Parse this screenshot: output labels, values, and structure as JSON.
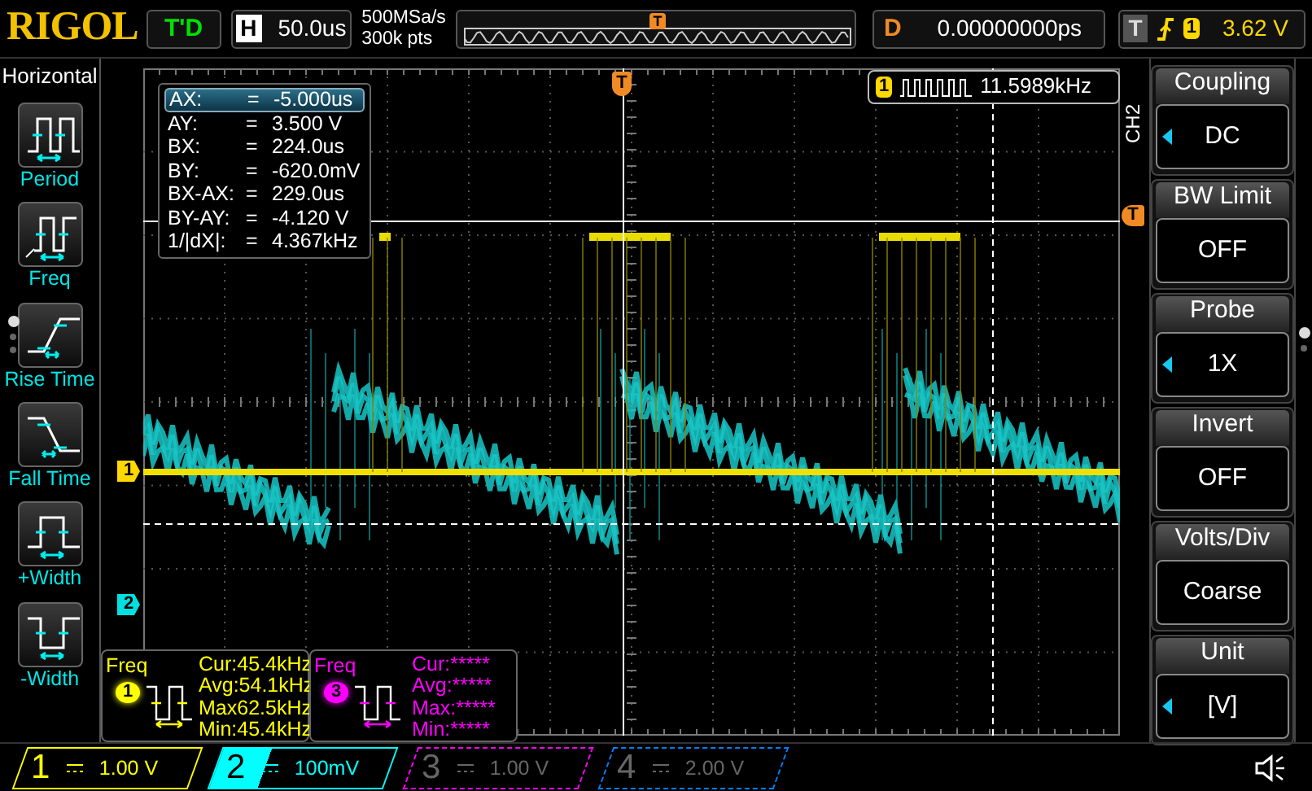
{
  "brand": "RIGOL",
  "run_status": "T'D",
  "horizontal": {
    "label": "H",
    "timebase": "50.0us",
    "sample_rate": "500MSa/s",
    "memory_depth": "300k pts",
    "marker": "T"
  },
  "delay": {
    "label": "D",
    "value": "0.00000000ps"
  },
  "trigger": {
    "label": "T",
    "channel": "1",
    "level": "3.62 V"
  },
  "left_menu": {
    "title": "Horizontal",
    "items": [
      {
        "label": "Period",
        "kind": "period"
      },
      {
        "label": "Freq",
        "kind": "freq"
      },
      {
        "label": "Rise Time",
        "kind": "rise"
      },
      {
        "label": "Fall Time",
        "kind": "fall"
      },
      {
        "label": "+Width",
        "kind": "pwidth"
      },
      {
        "label": "-Width",
        "kind": "nwidth"
      }
    ],
    "pages": [
      {
        "selected": true
      },
      {
        "selected": false
      },
      {
        "selected": false
      }
    ]
  },
  "cursor_readout": [
    {
      "name": "AX:",
      "equals": "=",
      "value": "-5.000us",
      "selected": true
    },
    {
      "name": "AY:",
      "equals": "=",
      "value": "3.500 V",
      "selected": false
    },
    {
      "name": "BX:",
      "equals": "=",
      "value": "224.0us",
      "selected": false
    },
    {
      "name": "BY:",
      "equals": "=",
      "value": "-620.0mV",
      "selected": false
    },
    {
      "name": "BX-AX:",
      "equals": "=",
      "value": "229.0us",
      "selected": false
    },
    {
      "name": "BY-AY:",
      "equals": "=",
      "value": "-4.120 V",
      "selected": false
    },
    {
      "name": "1/|dX|:",
      "equals": "=",
      "value": "4.367kHz",
      "selected": false
    }
  ],
  "frequency_counter": {
    "channel": "1",
    "value": "11.5989kHz"
  },
  "plot_markers": {
    "trigger_position": "T",
    "trigger_level": "T",
    "channel_1": "1",
    "channel_2": "2"
  },
  "measurements": [
    {
      "title": "Freq",
      "channel": "1",
      "color": "#ffff00",
      "rows": [
        {
          "label": "Cur:",
          "value": "45.4kHz"
        },
        {
          "label": "Avg:",
          "value": "54.1kHz"
        },
        {
          "label": "Max",
          "value": "62.5kHz"
        },
        {
          "label": "Min:",
          "value": "45.4kHz"
        }
      ]
    },
    {
      "title": "Freq",
      "channel": "3",
      "color": "#ff00ff",
      "rows": [
        {
          "label": "Cur:",
          "value": "*****"
        },
        {
          "label": "Avg:",
          "value": "*****"
        },
        {
          "label": "Max:",
          "value": "*****"
        },
        {
          "label": "Min:",
          "value": "*****"
        }
      ]
    }
  ],
  "channel_menu": {
    "label": "CH2",
    "items": [
      {
        "title": "Coupling",
        "value": "DC",
        "adjustable": true
      },
      {
        "title": "BW Limit",
        "value": "OFF",
        "adjustable": false
      },
      {
        "title": "Probe",
        "value": "1X",
        "adjustable": true
      },
      {
        "title": "Invert",
        "value": "OFF",
        "adjustable": false
      },
      {
        "title": "Volts/Div",
        "value": "Coarse",
        "adjustable": false
      },
      {
        "title": "Unit",
        "value": "[V]",
        "adjustable": true
      }
    ],
    "pages": [
      {
        "selected": true
      },
      {
        "selected": false
      }
    ]
  },
  "channels": [
    {
      "number": "1",
      "scale": "1.00 V",
      "color": "#ffff00",
      "on": true,
      "selected": false
    },
    {
      "number": "2",
      "scale": "100mV",
      "color": "#00ffff",
      "on": true,
      "selected": true
    },
    {
      "number": "3",
      "scale": "1.00 V",
      "color": "#ff00ff",
      "on": false,
      "selected": false
    },
    {
      "number": "4",
      "scale": "2.00 V",
      "color": "#0080ff",
      "on": false,
      "selected": false
    }
  ]
}
